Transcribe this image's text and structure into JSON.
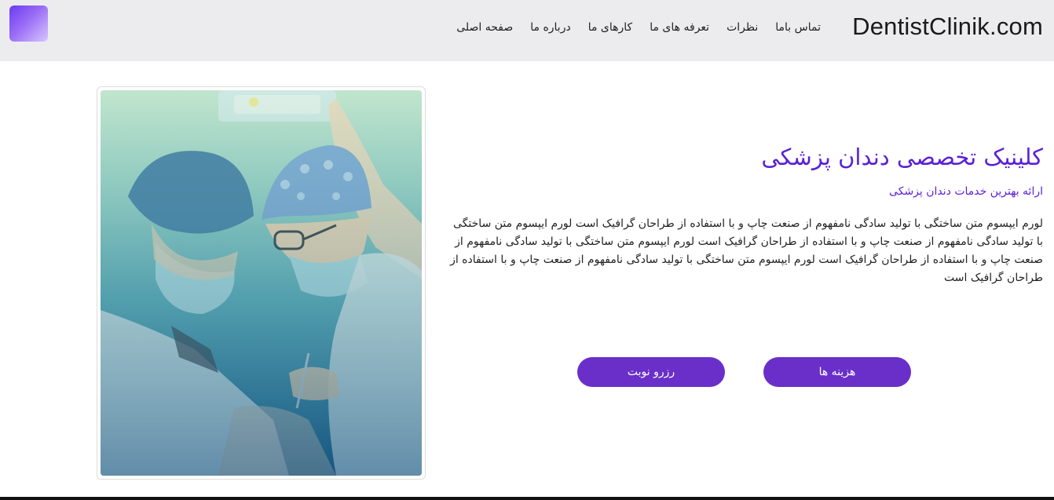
{
  "header": {
    "brand": "DentistClinik.com",
    "nav": [
      {
        "label": "صفحه اصلی"
      },
      {
        "label": "درباره ما"
      },
      {
        "label": "کارهای ما"
      },
      {
        "label": "تعرفه های ما"
      },
      {
        "label": "نظرات"
      },
      {
        "label": "تماس باما"
      }
    ],
    "logo_gradient": [
      "#6a3cf0",
      "#d8c6ff"
    ]
  },
  "hero": {
    "title": "کلینیک تخصصی دندان پزشکی",
    "subtitle": "ارائه بهترین خدمات دندان پزشکی",
    "body": "لورم ایپسوم متن ساختگی با تولید سادگی نامفهوم از صنعت چاپ و با استفاده از طراحان گرافیک است لورم ایپسوم متن ساختگی با تولید سادگی نامفهوم از صنعت چاپ و با استفاده از طراحان گرافیک است لورم ایپسوم متن ساختگی با تولید سادگی نامفهوم از صنعت چاپ و با استفاده از طراحان گرافیک است لورم ایپسوم متن ساختگی با تولید سادگی نامفهوم از صنعت چاپ و با استفاده از طراحان گرافیک است",
    "buttons": {
      "cost": "هزینه ها",
      "reserve": "رزرو نوبت"
    },
    "image_icon": "dentists-photo"
  },
  "colors": {
    "accent": "#5b1fd6",
    "button": "#6a2fc9",
    "header_bg": "#ececef"
  }
}
